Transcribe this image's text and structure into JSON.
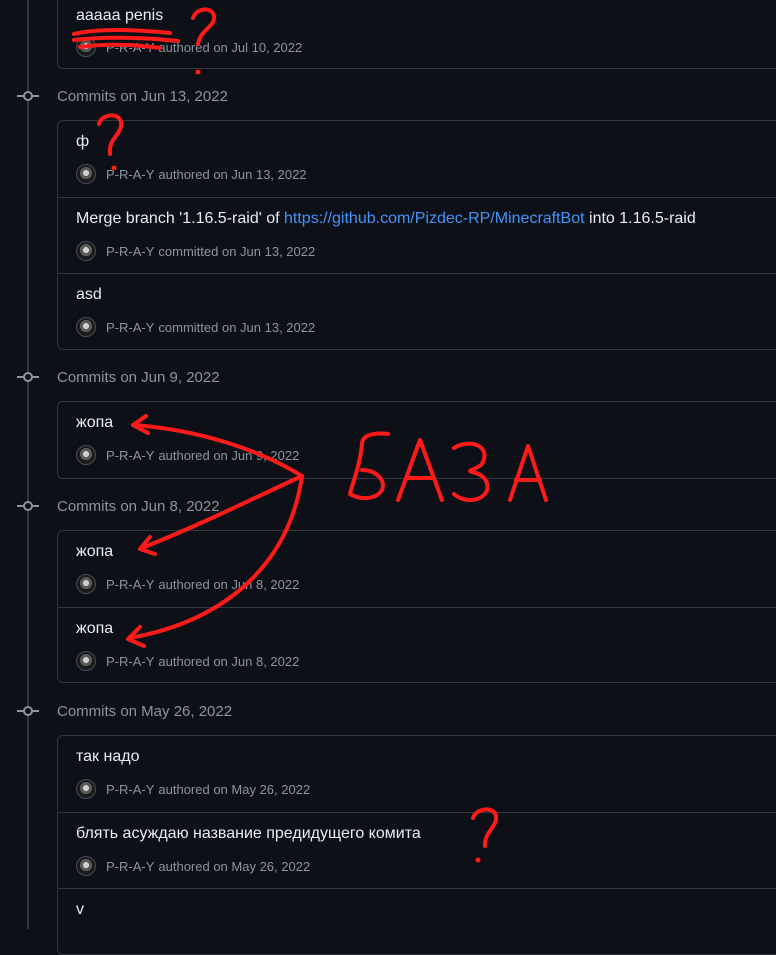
{
  "groups": [
    {
      "date_label": "",
      "commits": [
        {
          "message": "aaaaa penis",
          "author": "P-R-A-Y",
          "action": "authored on Jul 10, 2022"
        }
      ]
    },
    {
      "date_label": "Commits on Jun 13, 2022",
      "commits": [
        {
          "message": "ф",
          "author": "P-R-A-Y",
          "action": "authored on Jun 13, 2022"
        },
        {
          "message_pre": "Merge branch '1.16.5-raid' of ",
          "link": "https://github.com/Pizdec-RP/MinecraftBot",
          "message_post": " into 1.16.5-raid",
          "author": "P-R-A-Y",
          "action": "committed on Jun 13, 2022"
        },
        {
          "message": "asd",
          "author": "P-R-A-Y",
          "action": "committed on Jun 13, 2022"
        }
      ]
    },
    {
      "date_label": "Commits on Jun 9, 2022",
      "commits": [
        {
          "message": "жопа",
          "author": "P-R-A-Y",
          "action": "authored on Jun 9, 2022"
        }
      ]
    },
    {
      "date_label": "Commits on Jun 8, 2022",
      "commits": [
        {
          "message": "жопа",
          "author": "P-R-A-Y",
          "action": "authored on Jun 8, 2022"
        },
        {
          "message": "жопа",
          "author": "P-R-A-Y",
          "action": "authored on Jun 8, 2022"
        }
      ]
    },
    {
      "date_label": "Commits on May 26, 2022",
      "commits": [
        {
          "message": "так надо",
          "author": "P-R-A-Y",
          "action": "authored on May 26, 2022"
        },
        {
          "message": "блять асуждаю название предидущего комита",
          "author": "P-R-A-Y",
          "action": "authored on May 26, 2022"
        },
        {
          "message": "v",
          "author": "",
          "action": ""
        }
      ]
    }
  ],
  "annotation": {
    "handwritten_text": "БАЗА",
    "question_mark": "?",
    "color": "#ff1a1a"
  },
  "colors": {
    "background": "#0d1117",
    "border": "#30363d",
    "text": "#e6edf3",
    "muted": "#8b949e",
    "link": "#4493f8"
  }
}
